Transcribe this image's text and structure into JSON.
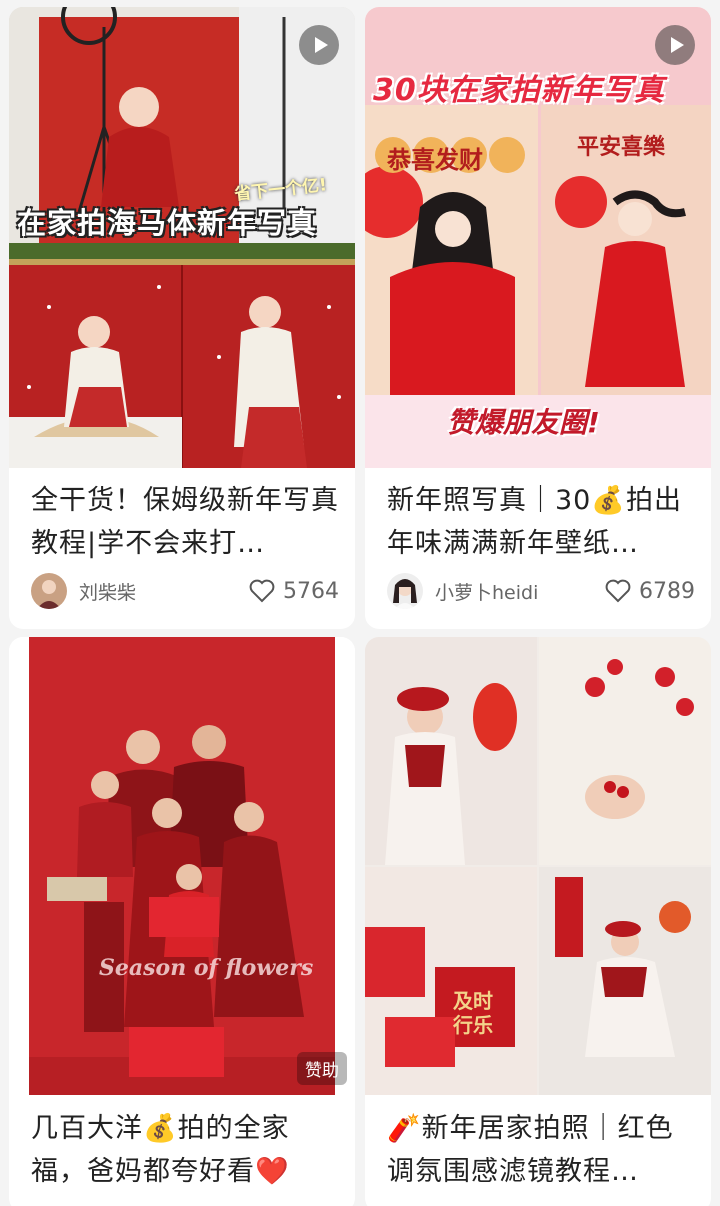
{
  "feed": [
    {
      "id": "note-1",
      "cover_caption": "在家拍海马体新年写真",
      "cover_sticker": "省下一个亿!",
      "is_video": true,
      "title": "全干货！保姆级新年写真教程|学不会来打…",
      "author": "刘柴柴",
      "likes": "5764"
    },
    {
      "id": "note-2",
      "cover_caption": "30块在家拍新年写真",
      "cover_sub_left": "恭喜发财",
      "cover_sub_right": "平安喜樂",
      "cover_bottom": "赞爆朋友圈!",
      "is_video": true,
      "title": "新年照写真｜30💰拍出年味满满新年壁纸…",
      "author": "小萝卜heidi",
      "likes": "6789"
    },
    {
      "id": "note-3",
      "cover_script": "Season of flowers",
      "badge": "赞助",
      "title": "几百大洋💰拍的全家福，爸妈都夸好看❤️"
    },
    {
      "id": "note-4",
      "cover_card": "及时行乐",
      "title": "🧨新年居家拍照｜红色调氛围感滤镜教程…"
    }
  ],
  "colors": {
    "background": "#f4f4f4",
    "card": "#ffffff",
    "text": "#222222",
    "meta": "#666666",
    "brand_red": "#c8161d"
  }
}
